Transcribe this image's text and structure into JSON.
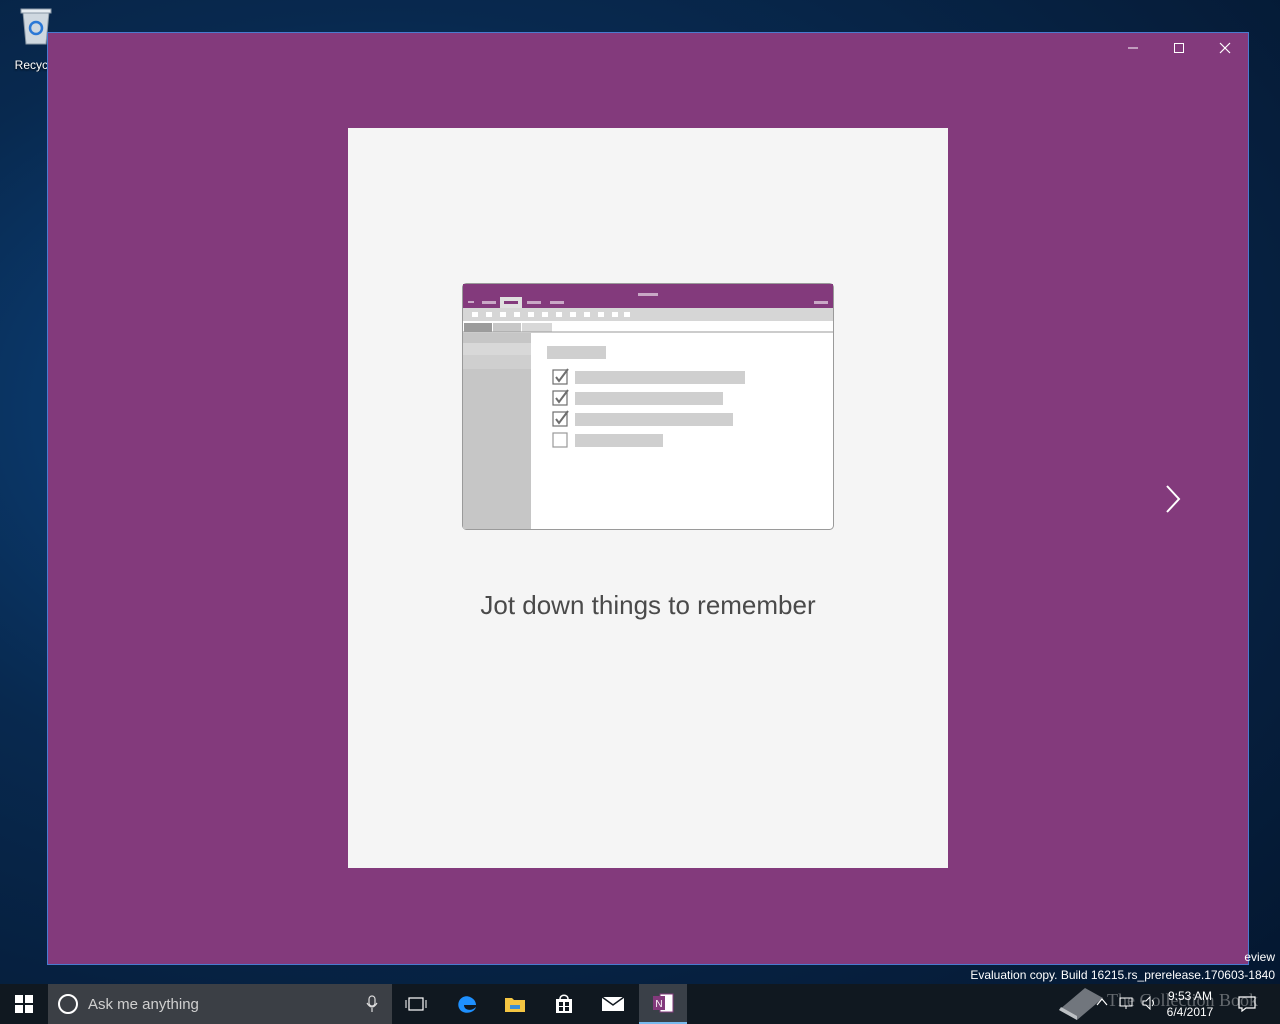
{
  "desktop": {
    "recycle_bin_label": "Recycle"
  },
  "window": {
    "bg_color": "#833a7c",
    "card": {
      "caption": "Jot down things to remember"
    }
  },
  "watermark": {
    "preview_fragment": "eview",
    "build_text": "Evaluation copy. Build 16215.rs_prerelease.170603-1840"
  },
  "taskbar": {
    "search_placeholder": "Ask me anything",
    "apps": [
      "start-icon",
      "task-view-icon",
      "edge-icon",
      "file-explorer-icon",
      "store-icon",
      "mail-icon",
      "onenote-icon"
    ],
    "clock_time": "9:53 AM",
    "clock_date": "6/4/2017",
    "overlay_text": "The Collection Book"
  }
}
